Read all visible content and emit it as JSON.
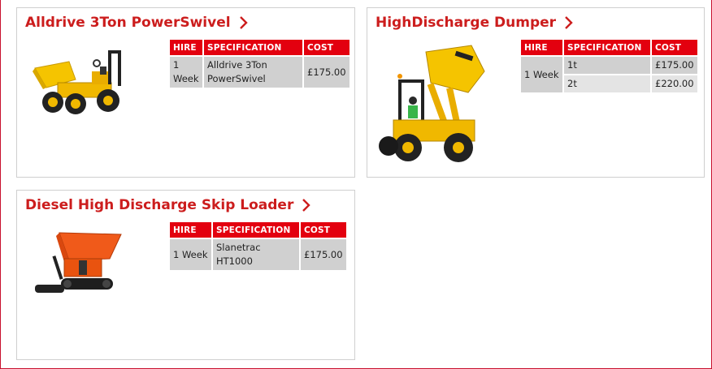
{
  "colors": {
    "accent": "#cc1d1d",
    "header_bg": "#e3000f",
    "cell_bg": "#d0d0d0",
    "cell_alt_bg": "#e4e4e4",
    "border": "#cfcfcf"
  },
  "products": [
    {
      "title": "Alldrive 3Ton PowerSwivel",
      "image_icon": "yellow-dumper-image",
      "headers": {
        "hire": "HIRE",
        "spec": "SPECIFICATION",
        "cost": "COST"
      },
      "rows": [
        {
          "hire": "1 Week",
          "spec": "Alldrive 3Ton PowerSwivel",
          "cost": "£175.00"
        }
      ]
    },
    {
      "title": "HighDischarge Dumper",
      "image_icon": "high-discharge-dumper-image",
      "headers": {
        "hire": "HIRE",
        "spec": "SPECIFICATION",
        "cost": "COST"
      },
      "hire_period": "1 Week",
      "rows": [
        {
          "spec": "1t",
          "cost": "£175.00"
        },
        {
          "spec": "2t",
          "cost": "£220.00"
        }
      ]
    },
    {
      "title": "Diesel High Discharge Skip Loader",
      "image_icon": "tracked-skip-loader-image",
      "headers": {
        "hire": "HIRE",
        "spec": "SPECIFICATION",
        "cost": "COST"
      },
      "rows": [
        {
          "hire": "1 Week",
          "spec": "Slanetrac HT1000",
          "cost": "£175.00"
        }
      ]
    }
  ]
}
